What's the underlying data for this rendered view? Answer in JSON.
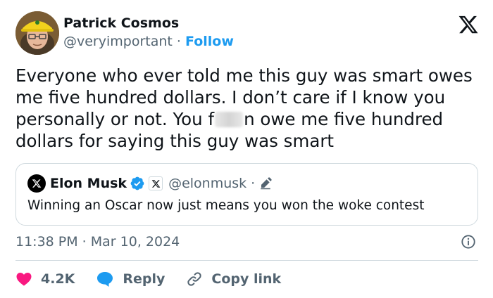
{
  "author": {
    "name": "Patrick Cosmos",
    "handle": "@veryimportant",
    "separator": "·",
    "follow_label": "Follow"
  },
  "tweet": {
    "text_before": "Everyone who ever told me this guy was smart owes me five hundred dollars. I don’t care if I know you personally or not. You f",
    "text_after": "n owe me five hundred dollars for saying this guy was smart"
  },
  "quote": {
    "name": "Elon Musk",
    "handle": "@elonmusk",
    "separator": "·",
    "text": "Winning an Oscar now just means you won the woke contest"
  },
  "meta": {
    "timestamp": "11:38 PM · Mar 10, 2024"
  },
  "actions": {
    "like_count": "4.2K",
    "reply_label": "Reply",
    "copy_label": "Copy link"
  },
  "colors": {
    "accent": "#1d9bf0",
    "like": "#f91880",
    "text": "#0f1419",
    "muted": "#536471",
    "border": "#cfd9de"
  },
  "icons": [
    "x-logo-icon",
    "verified-badge-icon",
    "x-affiliate-icon",
    "pencil-icon",
    "info-icon",
    "heart-icon",
    "reply-bubble-icon",
    "link-icon"
  ]
}
